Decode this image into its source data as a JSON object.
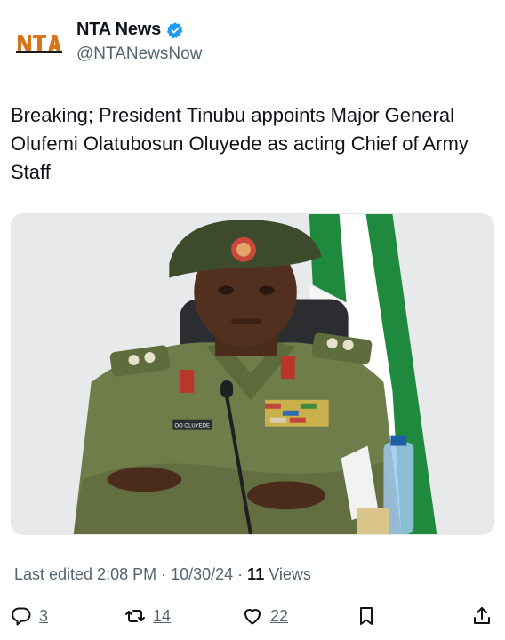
{
  "account": {
    "avatar_text": "NTA",
    "name": "NTA News",
    "handle": "@NTANewsNow"
  },
  "tweet": {
    "text": "Breaking; President Tinubu appoints Major General Olufemi Olatubosun Oluyede as acting Chief of Army Staff"
  },
  "media": {
    "name_tag": "OO OLUYEDE",
    "description_icon": "photo"
  },
  "meta": {
    "edited": "Last edited 2:08 PM · 10/30/24 ·",
    "views_count": "11",
    "views_label": "Views"
  },
  "actions": {
    "reply_count": "3",
    "repost_count": "14",
    "like_count": "22"
  },
  "icons": {
    "verified": "verified-badge-icon",
    "reply": "reply-icon",
    "repost": "repost-icon",
    "like": "heart-icon",
    "bookmark": "bookmark-icon",
    "share": "share-icon"
  },
  "colors": {
    "verified_blue": "#1d9bf0",
    "nta_orange": "#d8741a",
    "muted_text": "#536471",
    "uniform_green": "#6f7d4a",
    "flag_green": "#1f8a3e"
  }
}
